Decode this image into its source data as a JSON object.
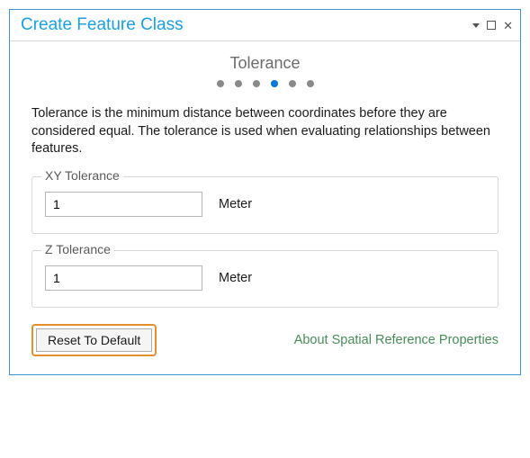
{
  "window": {
    "title": "Create Feature Class"
  },
  "step": {
    "title": "Tolerance",
    "active_index": 3,
    "total": 6
  },
  "description": "Tolerance is the minimum distance between coordinates before they are considered equal. The tolerance is used when evaluating relationships between features.",
  "xy_tolerance": {
    "legend": "XY Tolerance",
    "value": "1",
    "unit": "Meter"
  },
  "z_tolerance": {
    "legend": "Z Tolerance",
    "value": "1",
    "unit": "Meter"
  },
  "footer": {
    "reset_label": "Reset To Default",
    "about_link": "About Spatial Reference Properties"
  }
}
